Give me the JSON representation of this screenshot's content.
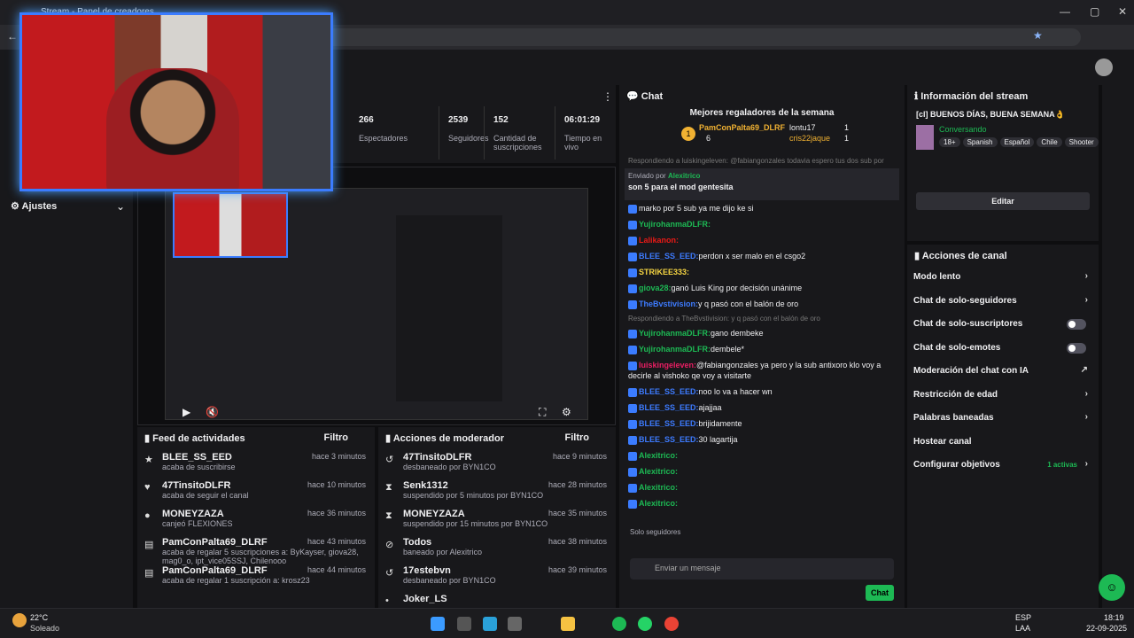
{
  "browser": {
    "tab_title": "Stream - Panel de creadores"
  },
  "leftnav": {
    "settings": "Ajustes"
  },
  "stats": [
    {
      "value": "266",
      "label": "Espectadores"
    },
    {
      "value": "2539",
      "label": "Seguidores"
    },
    {
      "value": "152",
      "label": "Cantidad de suscripciones"
    },
    {
      "value": "06:01:29",
      "label": "Tiempo en vivo"
    }
  ],
  "feed": {
    "title": "Feed de actividades",
    "filter": "Filtro",
    "items": [
      {
        "name": "BLEE_SS_EED",
        "desc": "acaba de suscribirse",
        "time": "hace 3 minutos"
      },
      {
        "name": "47TinsitoDLFR",
        "desc": "acaba de seguir el canal",
        "time": "hace 10 minutos"
      },
      {
        "name": "MONEYZAZA",
        "desc": "canjeó FLEXIONES",
        "time": "hace 36 minutos"
      },
      {
        "name": "PamConPalta69_DLRF",
        "desc": "acaba de regalar 5 suscripciones a: ByKayser, giova28, mag0_o, ipt_vice05SSJ, Chilenooo",
        "time": "hace 43 minutos"
      },
      {
        "name": "PamConPalta69_DLRF",
        "desc": "acaba de regalar 1 suscripción a: krosz23",
        "time": "hace 44 minutos"
      }
    ]
  },
  "mod": {
    "title": "Acciones de moderador",
    "filter": "Filtro",
    "items": [
      {
        "name": "47TinsitoDLFR",
        "desc": "desbaneado por BYN1CO",
        "time": "hace 9 minutos"
      },
      {
        "name": "Senk1312",
        "desc": "suspendido por 5 minutos por BYN1CO",
        "time": "hace 28 minutos"
      },
      {
        "name": "MONEYZAZA",
        "desc": "suspendido por 15 minutos por BYN1CO",
        "time": "hace 35 minutos"
      },
      {
        "name": "Todos",
        "desc": "baneado por Alexitrico",
        "time": "hace 38 minutos"
      },
      {
        "name": "17estebvn",
        "desc": "desbaneado por BYN1CO",
        "time": "hace 39 minutos"
      },
      {
        "name": "Joker_LS",
        "desc": "",
        "time": ""
      }
    ]
  },
  "chat": {
    "title": "Chat",
    "top_gifters_title": "Mejores regaladores de la semana",
    "gifters": [
      {
        "name": "PamConPalta69_DLRF",
        "count": "6"
      },
      {
        "name": "lontu17",
        "count": "1"
      },
      {
        "name": "cris22jaque",
        "count": "1"
      }
    ],
    "pinned_by": "Enviado por",
    "pinned_user": "Alexitrico",
    "pinned_text": "son 5 para el mod gentesita",
    "reply_note1": "Respondiendo a luiskingeleven: @fabiangonzales todavia espero tus dos sub por",
    "messages": [
      {
        "user": "",
        "text": "marko por 5 sub ya me dijo ke si",
        "color": "#efeff1"
      },
      {
        "user": "YujirohanmaDLFR:",
        "text": "",
        "color": "#1db954"
      },
      {
        "user": "Lalikanon:",
        "text": "",
        "color": "#e91916"
      },
      {
        "user": "BLEE_SS_EED:",
        "text": "perdon x ser malo en el csgo2",
        "color": "#3d7bff"
      },
      {
        "user": "STRIKEE333:",
        "text": "",
        "color": "#f5d442"
      },
      {
        "user": "giova28:",
        "text": "ganó Luis King por decisión unánime",
        "color": "#1db954"
      },
      {
        "user": "TheBvstivision:",
        "text": "y q pasó con el balón de oro",
        "color": "#3d7bff"
      }
    ],
    "reply_note2": "Respondiendo a TheBvstivision: y q pasó con el balón de oro",
    "messages2": [
      {
        "user": "YujirohanmaDLFR:",
        "text": "gano dembeke",
        "color": "#1db954"
      },
      {
        "user": "YujirohanmaDLFR:",
        "text": "dembele*",
        "color": "#1db954"
      },
      {
        "user": "luiskingeleven:",
        "text": "@fabiangonzales ya pero y la sub antixoro klo voy a decirle al vishoko qe voy a visitarte",
        "color": "#e91e63"
      },
      {
        "user": "BLEE_SS_EED:",
        "text": "noo lo va a hacer wn",
        "color": "#3d7bff"
      },
      {
        "user": "BLEE_SS_EED:",
        "text": "ajajjaa",
        "color": "#3d7bff"
      },
      {
        "user": "BLEE_SS_EED:",
        "text": "brijidamente",
        "color": "#3d7bff"
      },
      {
        "user": "BLEE_SS_EED:",
        "text": "30 lagartija",
        "color": "#3d7bff"
      },
      {
        "user": "Alexitrico:",
        "text": "",
        "color": "#1db954"
      },
      {
        "user": "Alexitrico:",
        "text": "",
        "color": "#1db954"
      },
      {
        "user": "Alexitrico:",
        "text": "",
        "color": "#1db954"
      },
      {
        "user": "Alexitrico:",
        "text": "",
        "color": "#1db954"
      }
    ],
    "followers_only": "Solo seguidores",
    "input_placeholder": "Enviar un mensaje",
    "send": "Chat"
  },
  "info": {
    "title": "Información del stream",
    "stream_title": "[cl] BUENOS DÍAS, BUENA SEMANA👌",
    "category": "Conversando",
    "tags": [
      "18+",
      "Spanish",
      "Español",
      "Chile",
      "Shooter"
    ],
    "edit": "Editar"
  },
  "actions": {
    "title": "Acciones de canal",
    "items": [
      {
        "label": "Modo lento",
        "kind": "arrow"
      },
      {
        "label": "Chat de solo-seguidores",
        "kind": "arrow"
      },
      {
        "label": "Chat de solo-suscriptores",
        "kind": "toggle"
      },
      {
        "label": "Chat de solo-emotes",
        "kind": "toggle"
      },
      {
        "label": "Moderación del chat con IA",
        "kind": "ext"
      },
      {
        "label": "Restricción de edad",
        "kind": "arrow"
      },
      {
        "label": "Palabras baneadas",
        "kind": "arrow"
      },
      {
        "label": "Hostear canal",
        "kind": "none"
      },
      {
        "label": "Configurar objetivos",
        "kind": "arrow",
        "extra": "1 activas"
      }
    ]
  },
  "taskbar": {
    "temp": "22°C",
    "weather": "Soleado",
    "lang1": "ESP",
    "lang2": "LAA",
    "time": "18:19",
    "date": "22-09-2025"
  }
}
